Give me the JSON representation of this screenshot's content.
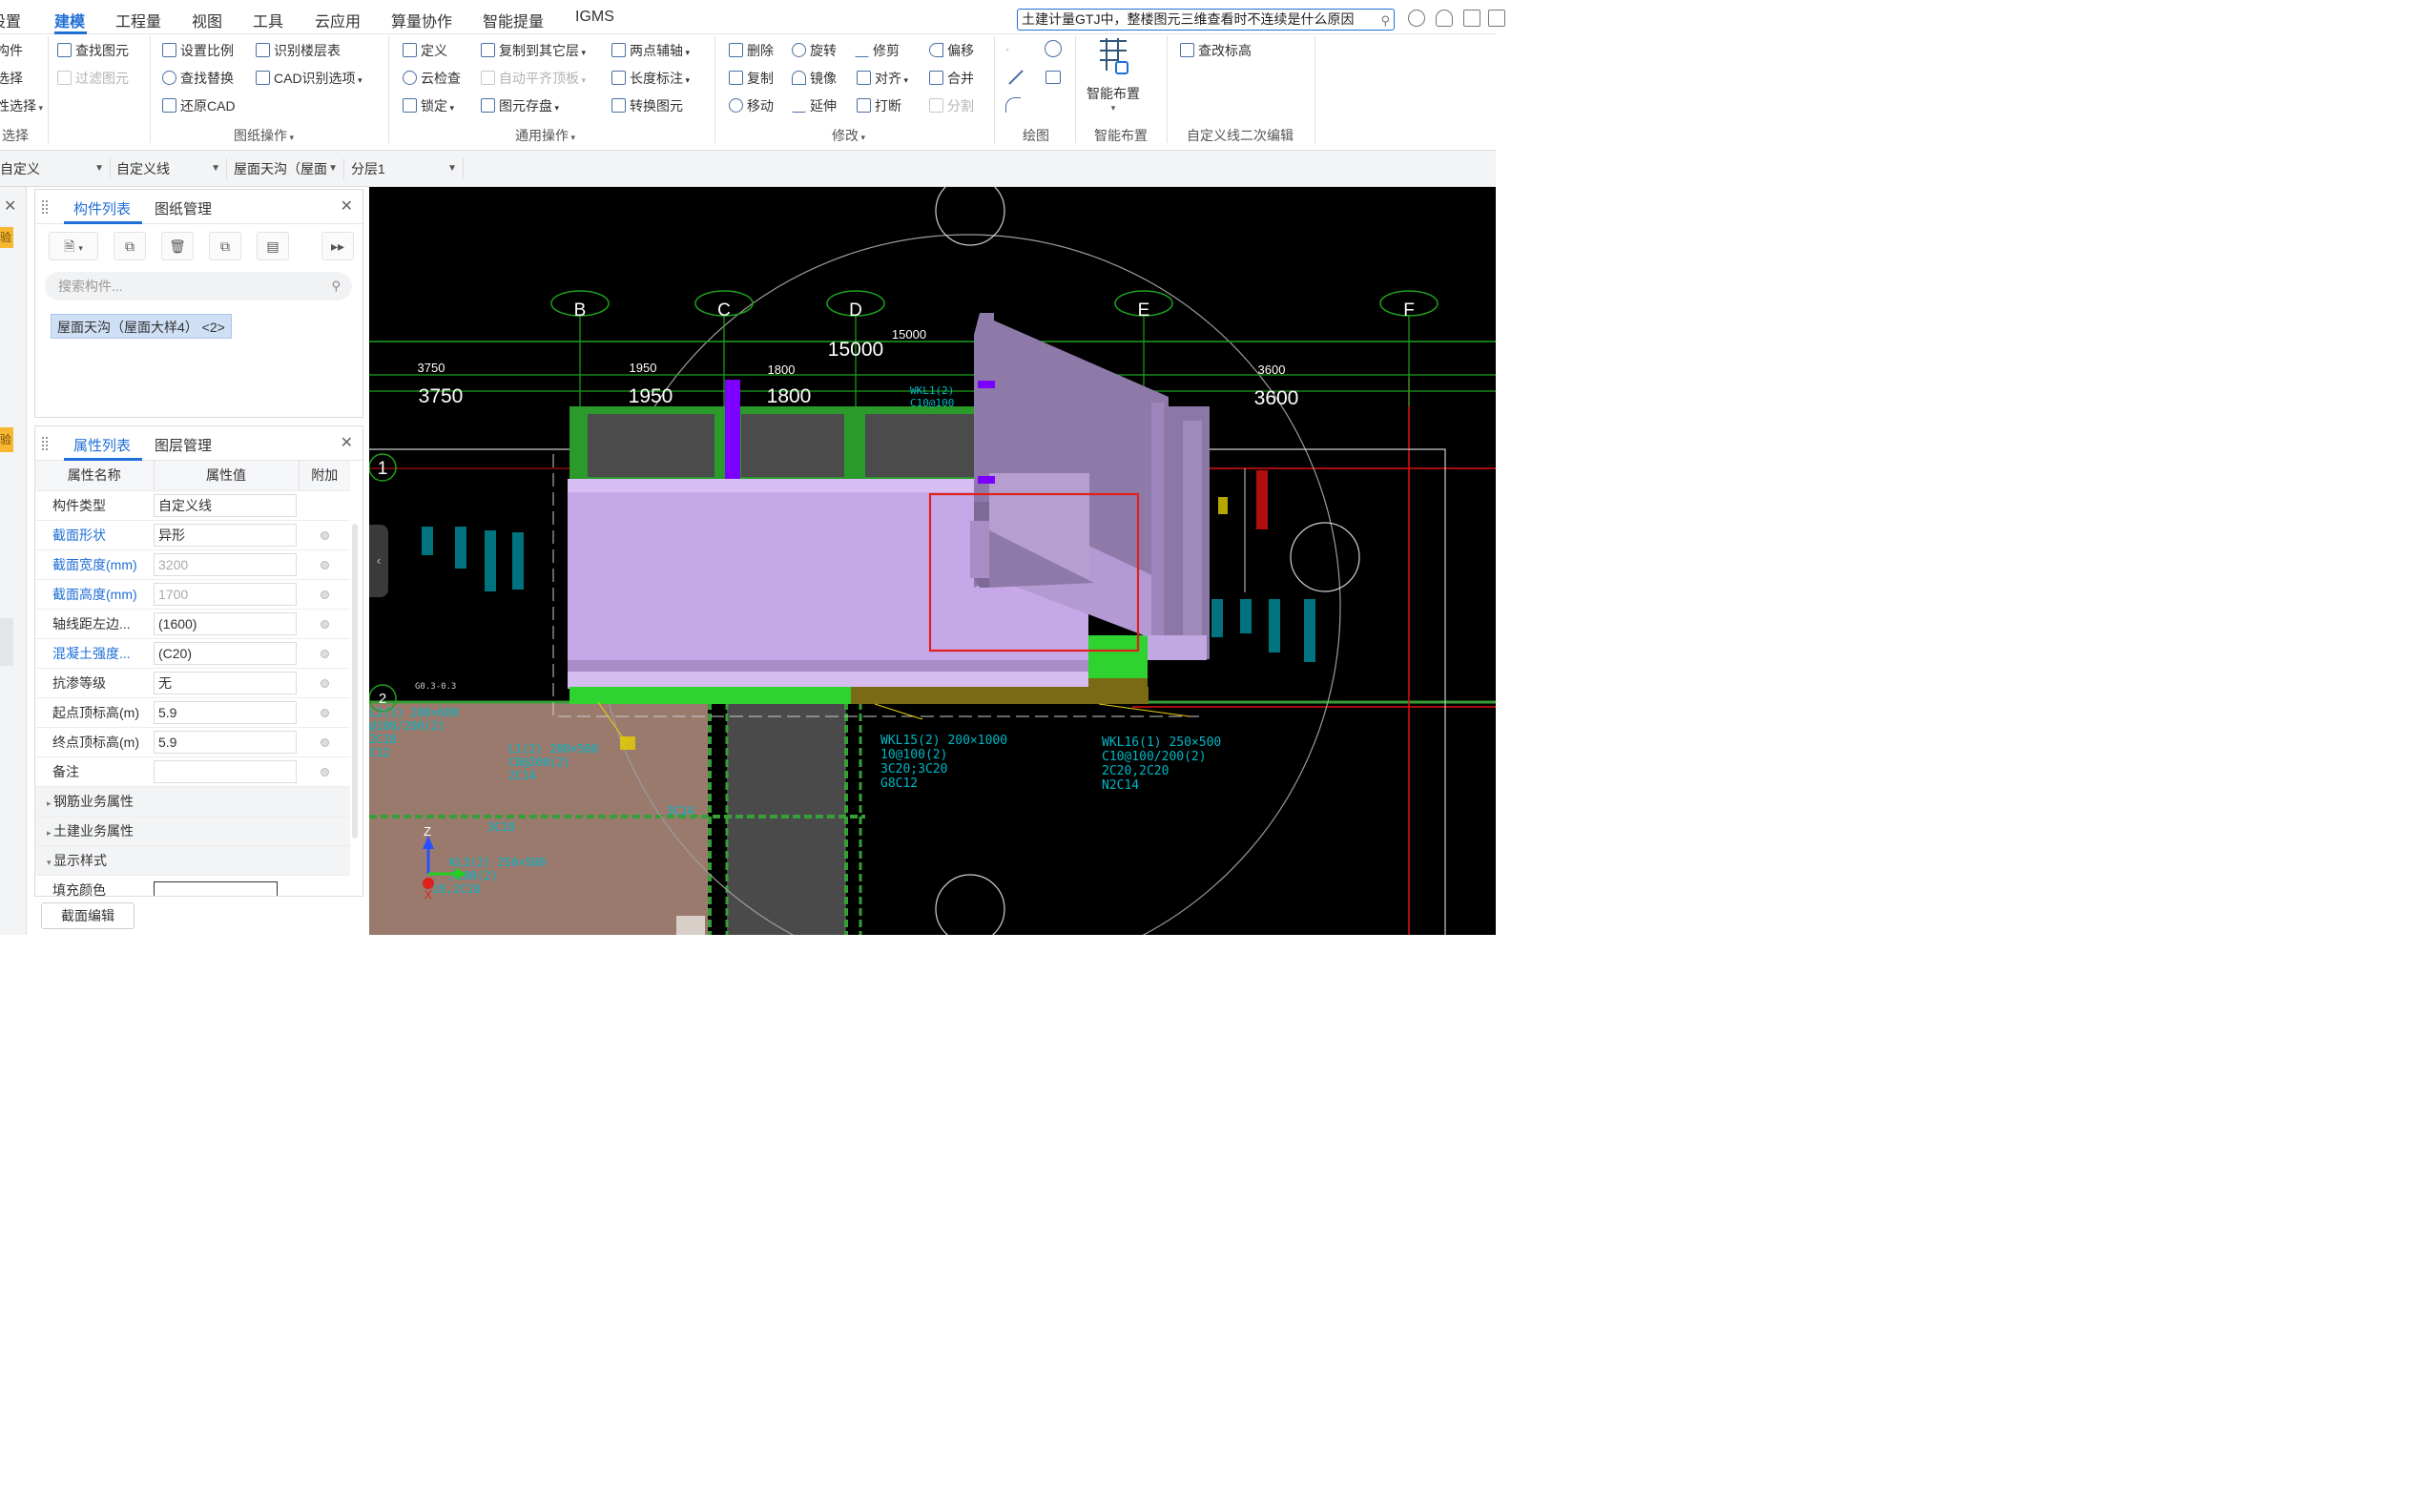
{
  "menubar": {
    "items": [
      "设置",
      "建模",
      "工程量",
      "视图",
      "工具",
      "云应用",
      "算量协作",
      "智能提量",
      "IGMS"
    ],
    "active": "建模",
    "help_search": "土建计量GTJ中，整楼图元三维查看时不连续是什么原因"
  },
  "ribbon": {
    "select_group": {
      "items": [
        "构件",
        "选择",
        "性选择"
      ],
      "label": "选择"
    },
    "drawing_ops": {
      "items": [
        "查找图元",
        "过滤图元",
        "设置比例",
        "识别楼层表",
        "查找替换",
        "CAD识别选项",
        "还原CAD"
      ],
      "label": "图纸操作"
    },
    "common_ops": {
      "items": [
        "定义",
        "复制到其它层",
        "两点辅轴",
        "云检查",
        "自动平齐顶板",
        "长度标注",
        "锁定",
        "图元存盘",
        "转换图元"
      ],
      "label": "通用操作"
    },
    "modify": {
      "items": [
        "删除",
        "旋转",
        "修剪",
        "偏移",
        "复制",
        "镜像",
        "对齐",
        "合并",
        "移动",
        "延伸",
        "打断",
        "分割"
      ],
      "label": "修改"
    },
    "draw": {
      "label": "绘图"
    },
    "smart": {
      "button": "智能布置",
      "label": "智能布置"
    },
    "custom_line": {
      "button": "查改标高",
      "label": "自定义线二次编辑"
    }
  },
  "filterbar": {
    "dropdowns": [
      "自定义",
      "自定义线",
      "屋面天沟（屋面",
      "分层1"
    ]
  },
  "component_panel": {
    "tabs": [
      "构件列表",
      "图纸管理"
    ],
    "search_placeholder": "搜索构件...",
    "item": "屋面天沟（屋面大样4） <2>"
  },
  "props_panel": {
    "tabs": [
      "属性列表",
      "图层管理"
    ],
    "headers": [
      "属性名称",
      "属性值",
      "附加"
    ],
    "rows": [
      {
        "name": "构件类型",
        "value": "自定义线",
        "blue": false,
        "grey": false,
        "dot": false
      },
      {
        "name": "截面形状",
        "value": "异形",
        "blue": true,
        "grey": false,
        "dot": true
      },
      {
        "name": "截面宽度(mm)",
        "value": "3200",
        "blue": true,
        "grey": true,
        "dot": true
      },
      {
        "name": "截面高度(mm)",
        "value": "1700",
        "blue": true,
        "grey": true,
        "dot": true
      },
      {
        "name": "轴线距左边...",
        "value": "(1600)",
        "blue": false,
        "grey": false,
        "dot": true
      },
      {
        "name": "混凝土强度...",
        "value": "(C20)",
        "blue": true,
        "grey": false,
        "dot": true
      },
      {
        "name": "抗渗等级",
        "value": "无",
        "blue": false,
        "grey": false,
        "dot": true
      },
      {
        "name": "起点顶标高(m)",
        "value": "5.9",
        "blue": false,
        "grey": false,
        "dot": true
      },
      {
        "name": "终点顶标高(m)",
        "value": "5.9",
        "blue": false,
        "grey": false,
        "dot": true
      },
      {
        "name": "备注",
        "value": "",
        "blue": false,
        "grey": false,
        "dot": true
      }
    ],
    "sections": [
      "钢筋业务属性",
      "土建业务属性",
      "显示样式"
    ],
    "fill_color_label": "填充颜色",
    "edit_button": "截面编辑"
  },
  "left_strip": {
    "badges": [
      "验",
      "验"
    ]
  },
  "viewport": {
    "axis_labels": [
      "B",
      "C",
      "D",
      "E",
      "F"
    ],
    "row_labels": [
      "1",
      "2"
    ],
    "dims_top": [
      "15000"
    ],
    "dims_mid": [
      "3750",
      "1950",
      "1800",
      "3600"
    ],
    "dims_large": [
      "15000",
      "3750",
      "1950",
      "1800",
      "3600"
    ],
    "beam_notes": [
      "WKL1(2)",
      "C10@100",
      "WKL15(2) 200×1000",
      "10@100(2)",
      "3C20;3C20",
      "G8C12",
      "WKL16(1) 250×500",
      "C10@100/200(2)",
      "2C20,2C20",
      "N2C14",
      "L1(2) 200×500",
      "C8@200(2)",
      "2C14",
      "L2(1) 200×600",
      "@100/200(2)",
      "2C18",
      "C12",
      "3C14",
      "3C18",
      "KL3(2) 250×500",
      "/200(2)",
      "18,2C18",
      "G0.3-0.3"
    ],
    "colors": {
      "gutter": "#c6a8e8",
      "gutter_dark": "#8e7aa8",
      "green": "#2fb82f",
      "purple": "#7b00ff",
      "highlight": "#e0201c",
      "cad_cyan": "#00b7c6"
    }
  }
}
